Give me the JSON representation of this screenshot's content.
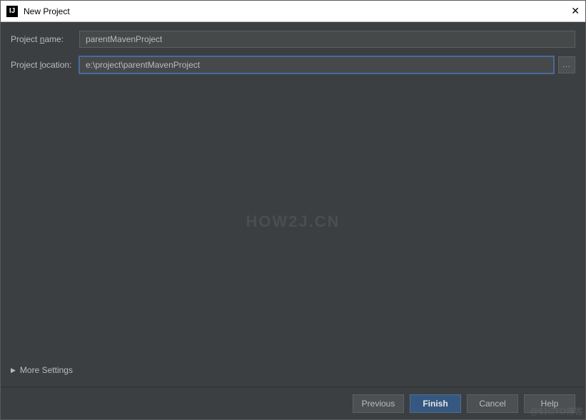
{
  "window": {
    "title": "New Project"
  },
  "form": {
    "name_label_pre": "Project ",
    "name_label_mn": "n",
    "name_label_post": "ame:",
    "name_value": "parentMavenProject",
    "location_label_pre": "Project ",
    "location_label_mn": "l",
    "location_label_post": "ocation:",
    "location_value": "e:\\project\\parentMavenProject",
    "browse_button": "..."
  },
  "more_settings": {
    "label": "More Settings"
  },
  "buttons": {
    "previous": "Previous",
    "finish": "Finish",
    "cancel": "Cancel",
    "help": "Help"
  },
  "watermark": {
    "text": "HOW2J.CN",
    "credit": "@51CTO博客"
  }
}
